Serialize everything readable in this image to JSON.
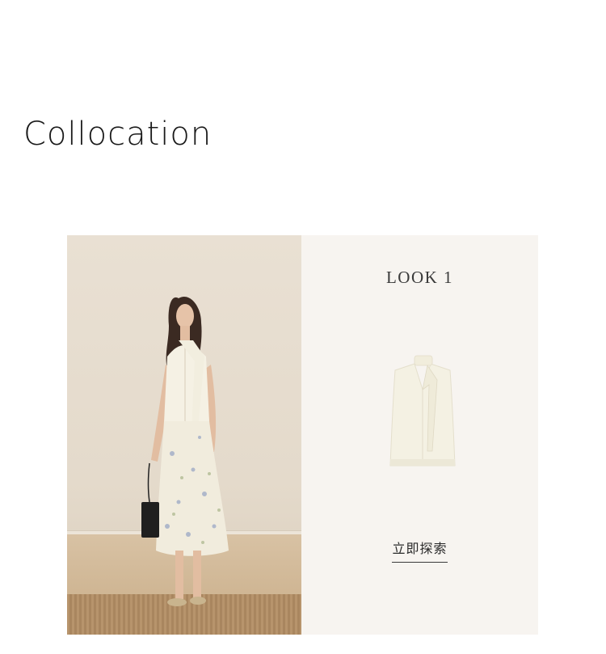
{
  "section": {
    "title": "Collocation"
  },
  "look": {
    "label": "LOOK 1",
    "cta_label": "立即探索"
  }
}
